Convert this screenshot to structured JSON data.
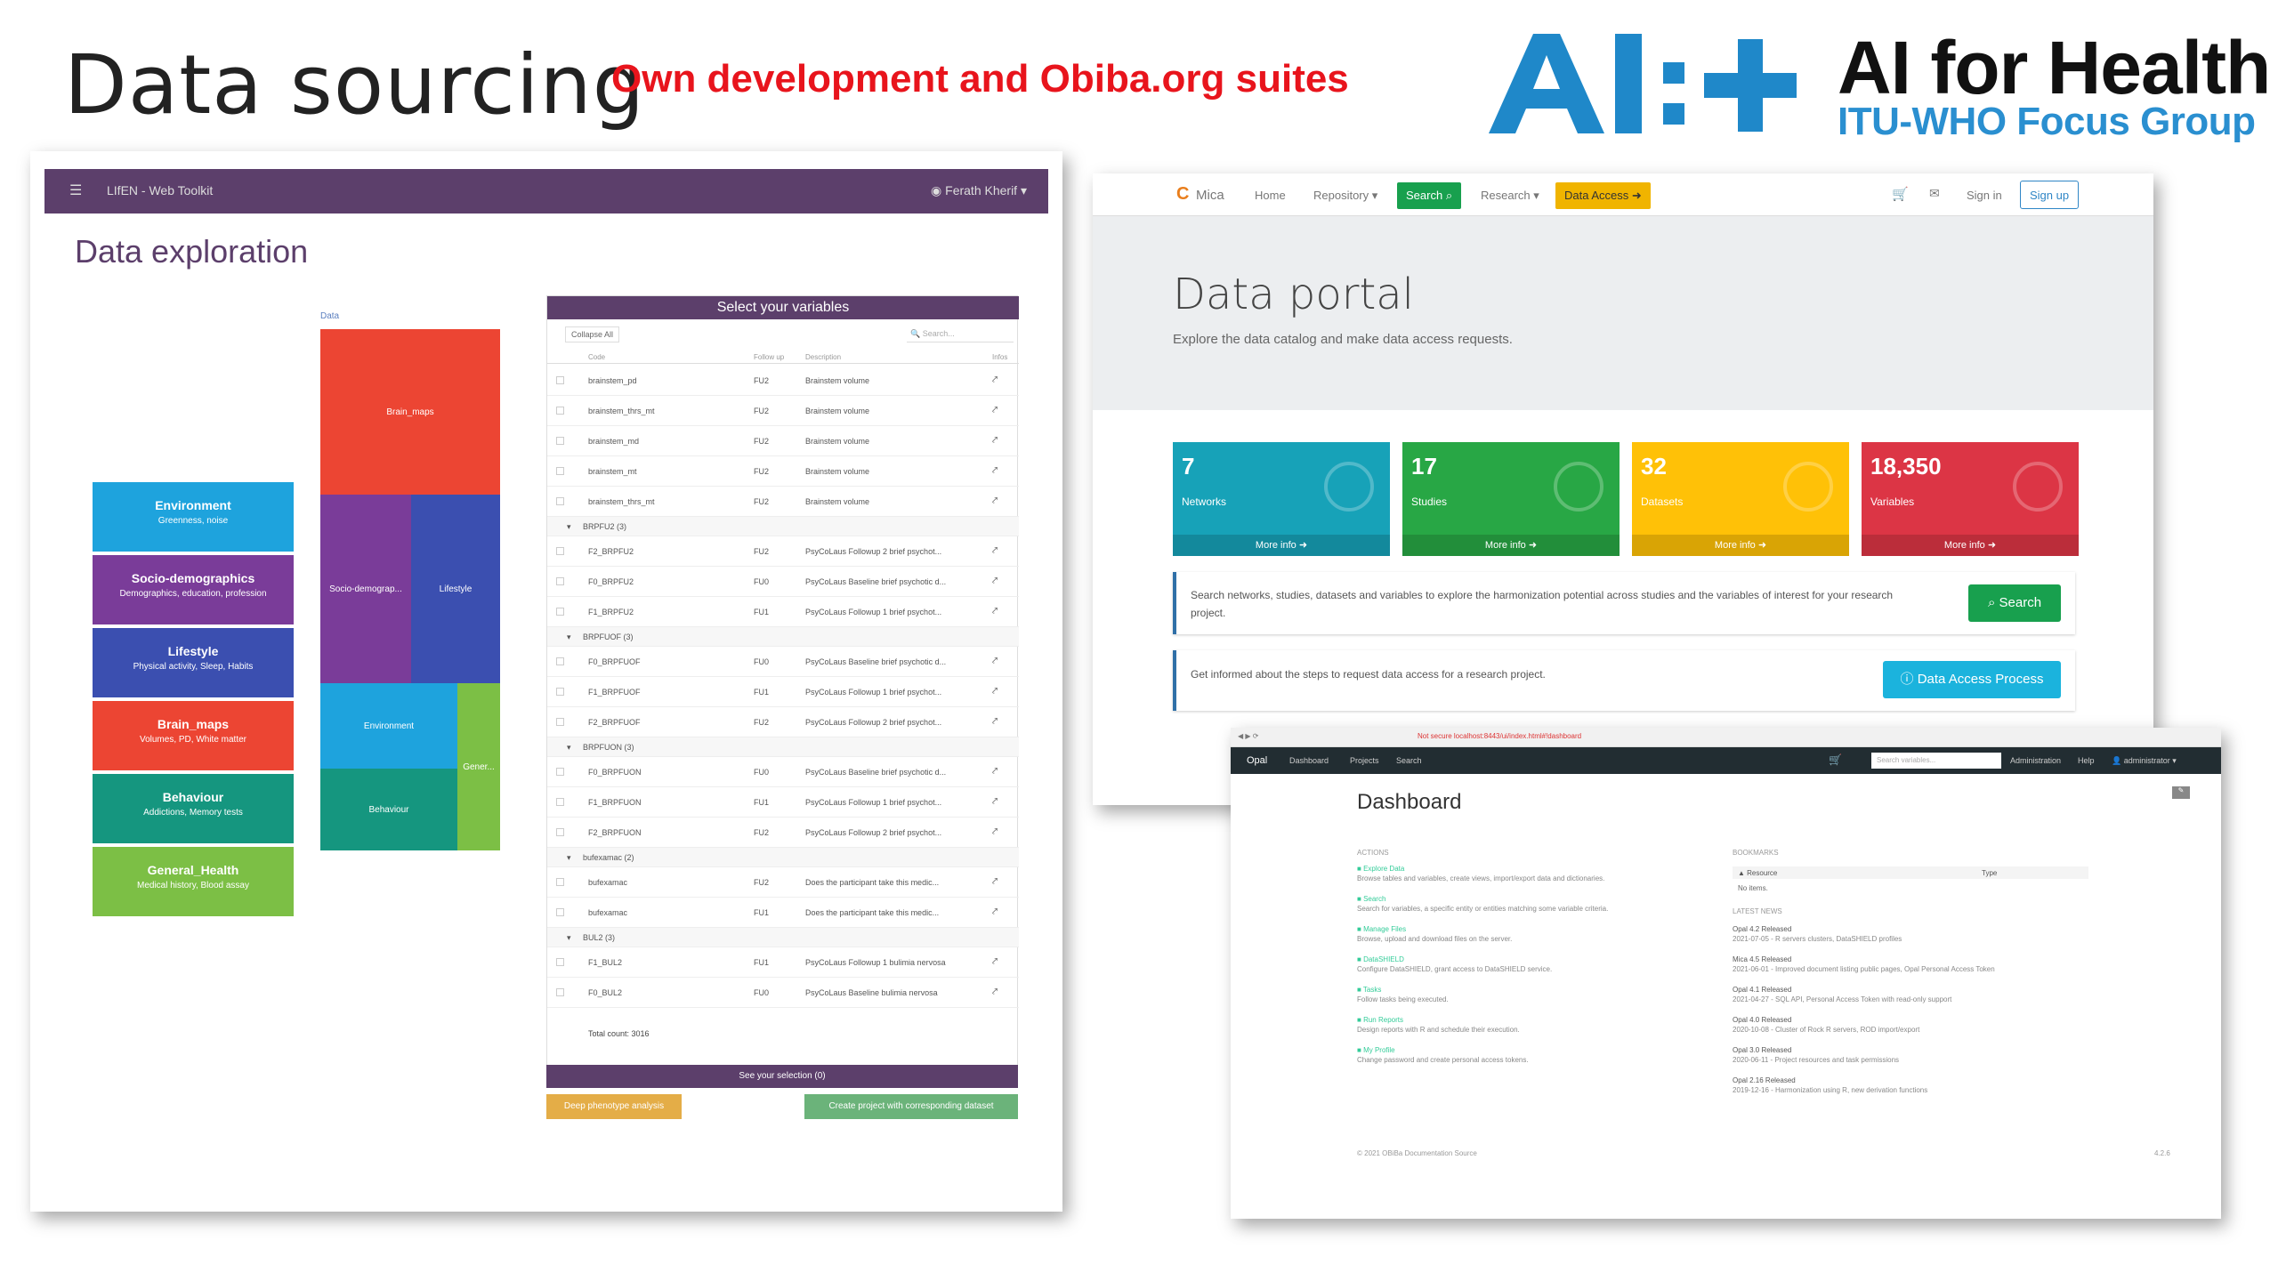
{
  "slide": {
    "title": "Data sourcing",
    "subtitle": "Own development and Obiba.org suites",
    "logo_title": "AI for Health",
    "logo_sub": "ITU-WHO Focus Group",
    "colors": {
      "subtitle": "#e8141c",
      "logo_blue": "#2a8fd0",
      "logo_ai": "#1f88c9"
    }
  },
  "lifen": {
    "app_title": "LIfEN - Web Toolkit",
    "user": "Ferath Kherif",
    "heading": "Data exploration",
    "treemap_label": "Data",
    "treemap": [
      {
        "label": "Brain_maps",
        "color": "#ec4533"
      },
      {
        "label": "Socio-demograp...",
        "color": "#7a3c99"
      },
      {
        "label": "Lifestyle",
        "color": "#3b4fb0"
      },
      {
        "label": "Environment",
        "color": "#1ea3dd"
      },
      {
        "label": "Behaviour",
        "color": "#15967f"
      },
      {
        "label": "Gener...",
        "color": "#7cbf45"
      }
    ],
    "categories": [
      {
        "name": "Environment",
        "desc": "Greenness, noise",
        "color": "#1ea3dd"
      },
      {
        "name": "Socio-demographics",
        "desc": "Demographics, education, profession",
        "color": "#7a3c99"
      },
      {
        "name": "Lifestyle",
        "desc": "Physical activity, Sleep, Habits",
        "color": "#3b4fb0"
      },
      {
        "name": "Brain_maps",
        "desc": "Volumes, PD, White matter",
        "color": "#ec4533"
      },
      {
        "name": "Behaviour",
        "desc": "Addictions, Memory tests",
        "color": "#15967f"
      },
      {
        "name": "General_Health",
        "desc": "Medical history, Blood assay",
        "color": "#7cbf45"
      }
    ],
    "panel_title": "Select your variables",
    "collapse_all": "Collapse All",
    "search_placeholder": "Search...",
    "columns": [
      "Code",
      "Follow up",
      "Description",
      "Infos"
    ],
    "rows": [
      {
        "type": "row",
        "code": "brainstem_pd",
        "fu": "FU2",
        "desc": "Brainstem volume"
      },
      {
        "type": "row",
        "code": "brainstem_thrs_mt",
        "fu": "FU2",
        "desc": "Brainstem volume"
      },
      {
        "type": "row",
        "code": "brainstem_md",
        "fu": "FU2",
        "desc": "Brainstem volume"
      },
      {
        "type": "row",
        "code": "brainstem_mt",
        "fu": "FU2",
        "desc": "Brainstem volume"
      },
      {
        "type": "row",
        "code": "brainstem_thrs_mt",
        "fu": "FU2",
        "desc": "Brainstem volume"
      },
      {
        "type": "group",
        "code": "BRPFU2 (3)"
      },
      {
        "type": "row",
        "code": "F2_BRPFU2",
        "fu": "FU2",
        "desc": "PsyCoLaus Followup 2 brief psychot..."
      },
      {
        "type": "row",
        "code": "F0_BRPFU2",
        "fu": "FU0",
        "desc": "PsyCoLaus Baseline brief psychotic d..."
      },
      {
        "type": "row",
        "code": "F1_BRPFU2",
        "fu": "FU1",
        "desc": "PsyCoLaus Followup 1 brief psychot..."
      },
      {
        "type": "group",
        "code": "BRPFUOF (3)"
      },
      {
        "type": "row",
        "code": "F0_BRPFUOF",
        "fu": "FU0",
        "desc": "PsyCoLaus Baseline brief psychotic d..."
      },
      {
        "type": "row",
        "code": "F1_BRPFUOF",
        "fu": "FU1",
        "desc": "PsyCoLaus Followup 1 brief psychot..."
      },
      {
        "type": "row",
        "code": "F2_BRPFUOF",
        "fu": "FU2",
        "desc": "PsyCoLaus Followup 2 brief psychot..."
      },
      {
        "type": "group",
        "code": "BRPFUON (3)"
      },
      {
        "type": "row",
        "code": "F0_BRPFUON",
        "fu": "FU0",
        "desc": "PsyCoLaus Baseline brief psychotic d..."
      },
      {
        "type": "row",
        "code": "F1_BRPFUON",
        "fu": "FU1",
        "desc": "PsyCoLaus Followup 1 brief psychot..."
      },
      {
        "type": "row",
        "code": "F2_BRPFUON",
        "fu": "FU2",
        "desc": "PsyCoLaus Followup 2 brief psychot..."
      },
      {
        "type": "group",
        "code": "bufexamac (2)"
      },
      {
        "type": "row",
        "code": "bufexamac",
        "fu": "FU2",
        "desc": "Does the participant take this medic..."
      },
      {
        "type": "row",
        "code": "bufexamac",
        "fu": "FU1",
        "desc": "Does the participant take this medic..."
      },
      {
        "type": "group",
        "code": "BUL2 (3)"
      },
      {
        "type": "row",
        "code": "F1_BUL2",
        "fu": "FU1",
        "desc": "PsyCoLaus Followup 1 bulimia nervosa"
      },
      {
        "type": "row",
        "code": "F0_BUL2",
        "fu": "FU0",
        "desc": "PsyCoLaus Baseline bulimia nervosa"
      }
    ],
    "total_count": "Total count: 3016",
    "see_selection": "See your selection (0)",
    "btn_deep": "Deep phenotype analysis",
    "btn_create": "Create project with corresponding dataset"
  },
  "mica": {
    "brand": "Mica",
    "nav": [
      "Home",
      "Repository",
      "Search",
      "Research",
      "Data Access"
    ],
    "nav_right": [
      "Sign in",
      "Sign up"
    ],
    "hero_title": "Data portal",
    "hero_lead": "Explore the data catalog and make data access requests.",
    "stats": [
      {
        "num": "7",
        "label": "Networks",
        "more": "More info",
        "color": "#17a2b8"
      },
      {
        "num": "17",
        "label": "Studies",
        "more": "More info",
        "color": "#28a745"
      },
      {
        "num": "32",
        "label": "Datasets",
        "more": "More info",
        "color": "#ffc107"
      },
      {
        "num": "18,350",
        "label": "Variables",
        "more": "More info",
        "color": "#dc3545"
      }
    ],
    "callout1": "Search networks, studies, datasets and variables to explore the harmonization potential across studies and the variables of interest for your research project.",
    "btn_search": "Search",
    "callout2": "Get informed about the steps to request data access for a research project.",
    "btn_dap": "Data Access Process"
  },
  "opal": {
    "url": "Not secure   localhost:8443/ui/index.html#!dashboard",
    "brand": "Opal",
    "nav": [
      "Dashboard",
      "Projects",
      "Search"
    ],
    "nav_right": [
      "Administration",
      "Help",
      "administrator"
    ],
    "search_placeholder": "Search variables...",
    "heading": "Dashboard",
    "actions_title": "ACTIONS",
    "actions": [
      {
        "label": "Explore Data",
        "desc": "Browse tables and variables, create views, import/export data and dictionaries."
      },
      {
        "label": "Search",
        "desc": "Search for variables, a specific entity or entities matching some variable criteria."
      },
      {
        "label": "Manage Files",
        "desc": "Browse, upload and download files on the server."
      },
      {
        "label": "DataSHIELD",
        "desc": "Configure DataSHIELD, grant access to DataSHIELD service."
      },
      {
        "label": "Tasks",
        "desc": "Follow tasks being executed."
      },
      {
        "label": "Run Reports",
        "desc": "Design reports with R and schedule their execution."
      },
      {
        "label": "My Profile",
        "desc": "Change password and create personal access tokens."
      }
    ],
    "bookmarks_title": "BOOKMARKS",
    "bookmark_cols": [
      "Resource",
      "Type"
    ],
    "bookmark_empty": "No items.",
    "news_title": "LATEST NEWS",
    "news": [
      {
        "title": "Opal 4.2 Released",
        "text": "2021-07-05 - R servers clusters, DataSHIELD profiles"
      },
      {
        "title": "Mica 4.5 Released",
        "text": "2021-06-01 - Improved document listing public pages, Opal Personal Access Token"
      },
      {
        "title": "Opal 4.1 Released",
        "text": "2021-04-27 - SQL API, Personal Access Token with read-only support"
      },
      {
        "title": "Opal 4.0 Released",
        "text": "2020-10-08 - Cluster of Rock R servers, ROD import/export"
      },
      {
        "title": "Opal 3.0 Released",
        "text": "2020-06-11 - Project resources and task permissions"
      },
      {
        "title": "Opal 2.16 Released",
        "text": "2019-12-16 - Harmonization using R, new derivation functions"
      }
    ],
    "footer": "© 2021 OBiBa   Documentation   Source",
    "version": "4.2.6"
  }
}
